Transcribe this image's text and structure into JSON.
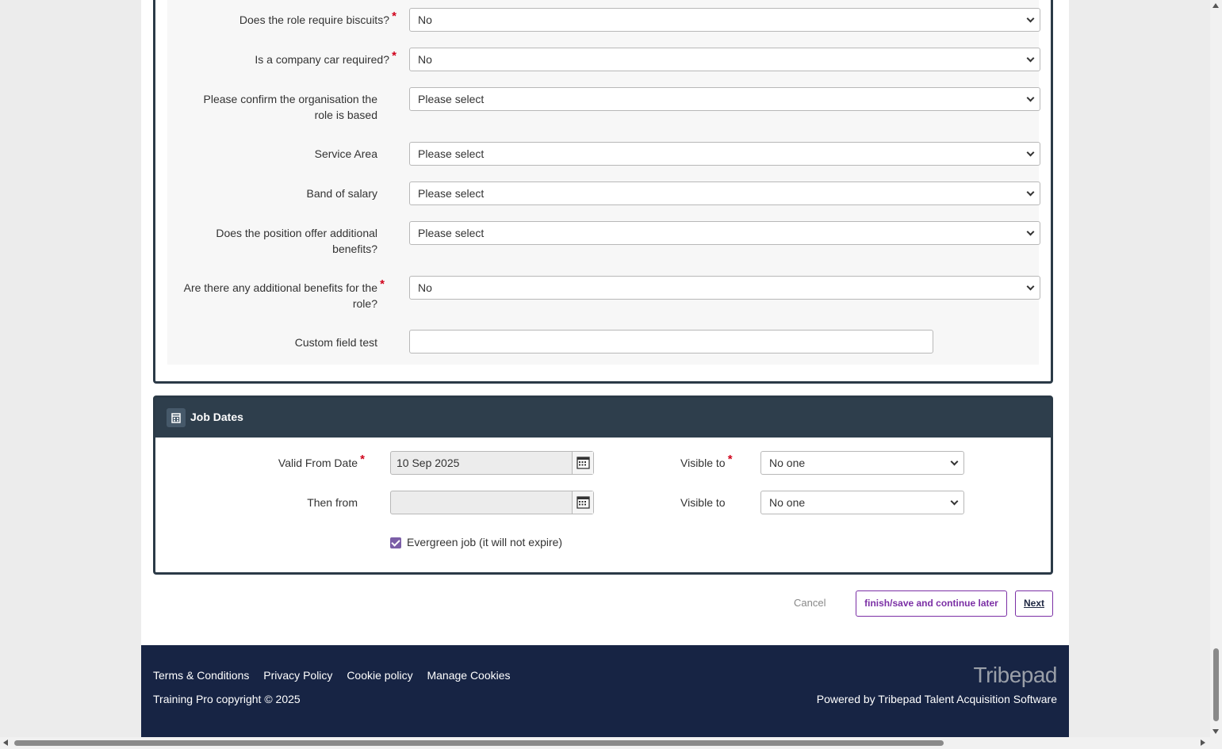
{
  "custom_fields": [
    {
      "label": "Does the role require biscuits?",
      "required": "*",
      "value": "No",
      "type": "select"
    },
    {
      "label": "Is a company car required?",
      "required": "*",
      "value": "No",
      "type": "select"
    },
    {
      "label": "Please confirm the organisation the role is based",
      "required": "",
      "value": "Please select",
      "type": "select"
    },
    {
      "label": "Service Area",
      "required": "",
      "value": "Please select",
      "type": "select"
    },
    {
      "label": "Band of salary",
      "required": "",
      "value": "Please select",
      "type": "select"
    },
    {
      "label": "Does the position offer additional benefits?",
      "required": "",
      "value": "Please select",
      "type": "select"
    },
    {
      "label": "Are there any additional benefits for the role?",
      "required": "*",
      "value": "No",
      "type": "select"
    },
    {
      "label": "Custom field test",
      "required": "",
      "value": "",
      "type": "text"
    }
  ],
  "job_dates": {
    "title": "Job Dates",
    "valid_from_label": "Valid From Date",
    "valid_from_value": "10 Sep 2025",
    "then_from_label": "Then from",
    "then_from_value": "",
    "visible_to_label_1": "Visible to",
    "visible_to_value_1": "No one",
    "visible_to_label_2": "Visible to",
    "visible_to_value_2": "No one",
    "evergreen_label": "Evergreen job (it will not expire)",
    "required_mark": "*"
  },
  "actions": {
    "cancel": "Cancel",
    "save": "finish/save and continue later",
    "next": "Next"
  },
  "footer": {
    "links": [
      "Terms & Conditions",
      "Privacy Policy",
      "Cookie policy",
      "Manage Cookies"
    ],
    "copyright": "Training Pro copyright © 2025",
    "brand": "Tribepad",
    "powered": "Powered by Tribepad Talent Acquisition Software"
  },
  "colors": {
    "panel_header": "#2e3e4c",
    "footer_bg": "#172444",
    "accent_purple": "#7b2fa5",
    "required_red": "#d0021b"
  }
}
